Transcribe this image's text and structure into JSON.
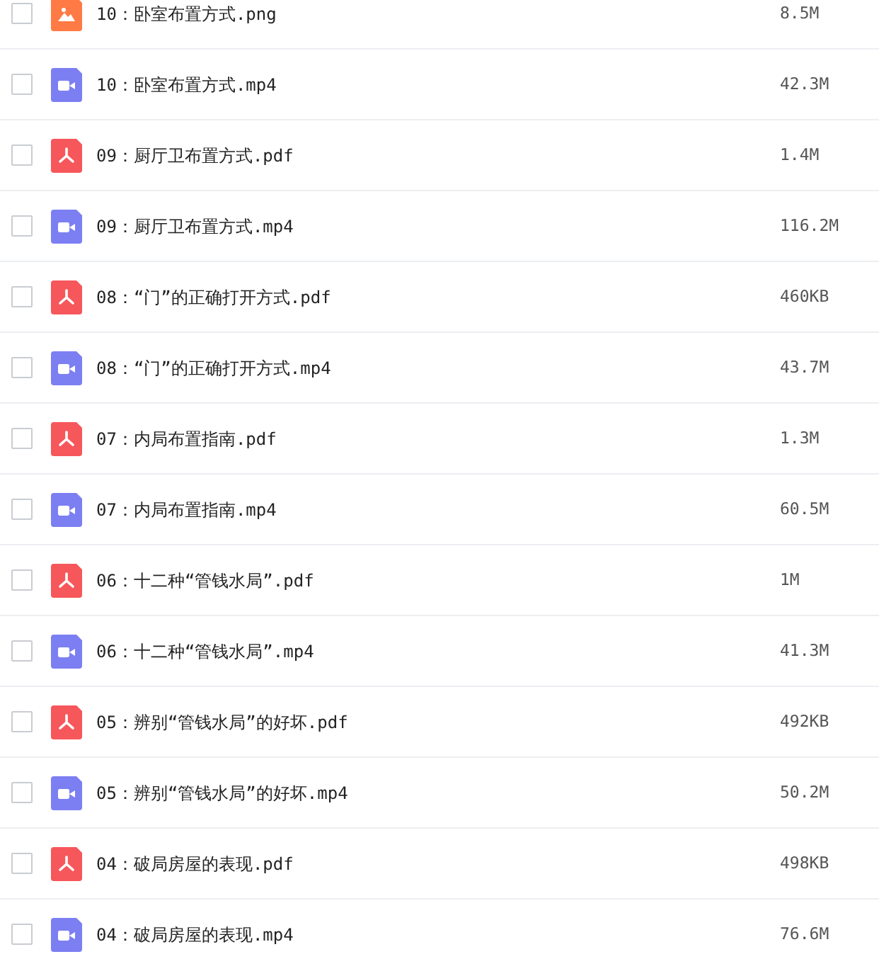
{
  "files": [
    {
      "kind": "image",
      "checked": false,
      "name": "10：卧室布置方式.png",
      "size": "8.5M"
    },
    {
      "kind": "video",
      "checked": false,
      "name": "10：卧室布置方式.mp4",
      "size": "42.3M"
    },
    {
      "kind": "pdf",
      "checked": false,
      "name": "09：厨厅卫布置方式.pdf",
      "size": "1.4M"
    },
    {
      "kind": "video",
      "checked": false,
      "name": "09：厨厅卫布置方式.mp4",
      "size": "116.2M"
    },
    {
      "kind": "pdf",
      "checked": false,
      "name": "08：“门”的正确打开方式.pdf",
      "size": "460KB"
    },
    {
      "kind": "video",
      "checked": false,
      "name": "08：“门”的正确打开方式.mp4",
      "size": "43.7M"
    },
    {
      "kind": "pdf",
      "checked": false,
      "name": "07：内局布置指南.pdf",
      "size": "1.3M"
    },
    {
      "kind": "video",
      "checked": false,
      "name": "07：内局布置指南.mp4",
      "size": "60.5M"
    },
    {
      "kind": "pdf",
      "checked": false,
      "name": "06：十二种“管钱水局”.pdf",
      "size": "1M"
    },
    {
      "kind": "video",
      "checked": false,
      "name": "06：十二种“管钱水局”.mp4",
      "size": "41.3M"
    },
    {
      "kind": "pdf",
      "checked": false,
      "name": "05：辨别“管钱水局”的好坏.pdf",
      "size": "492KB"
    },
    {
      "kind": "video",
      "checked": false,
      "name": "05：辨别“管钱水局”的好坏.mp4",
      "size": "50.2M"
    },
    {
      "kind": "pdf",
      "checked": false,
      "name": "04：破局房屋的表现.pdf",
      "size": "498KB"
    },
    {
      "kind": "video",
      "checked": false,
      "name": "04：破局房屋的表现.mp4",
      "size": "76.6M"
    }
  ]
}
